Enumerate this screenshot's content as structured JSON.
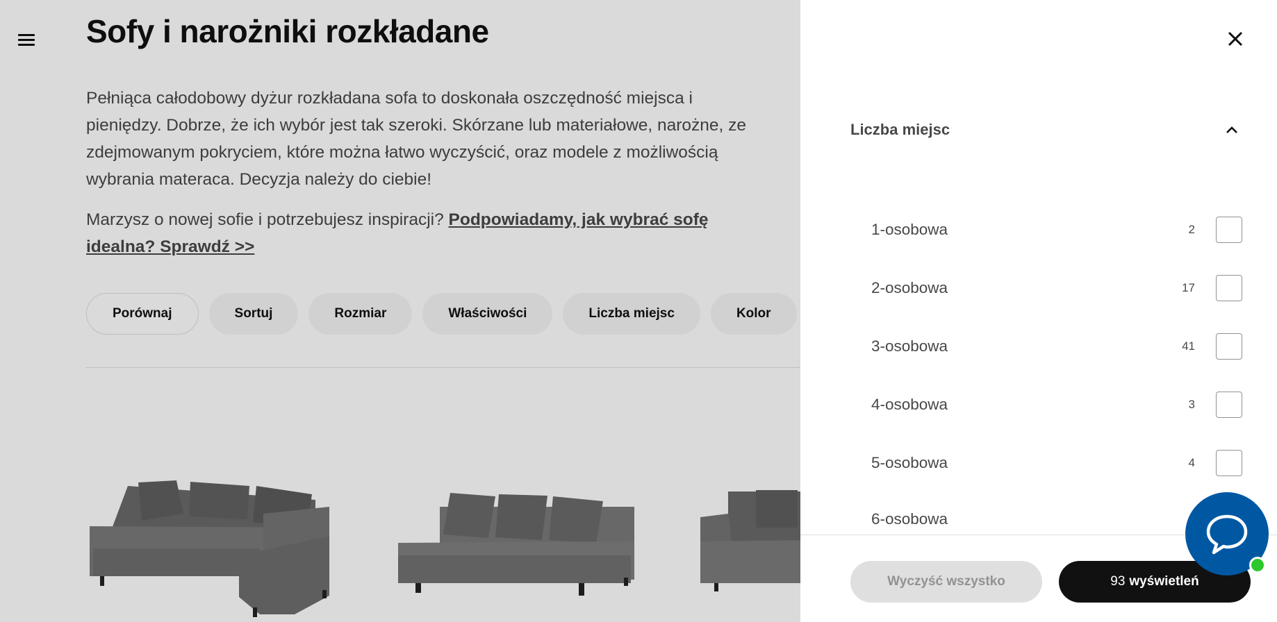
{
  "page": {
    "title": "Sofy i narożniki rozkładane",
    "description": "Pełniąca całodobowy dyżur rozkładana sofa to doskonała oszczędność miejsca i pieniędzy. Dobrze, że ich wybór jest tak szeroki. Skórzane lub materiałowe, narożne, ze zdejmowanym pokryciem, które można łatwo wyczyścić, oraz modele z możliwością wybrania materaca. Decyzja należy do ciebie!",
    "inspiration_text": "Marzysz o nowej sofie i potrzebujesz inspiracji? ",
    "inspiration_link": "Podpowiadamy, jak wybrać sofę idealna? Sprawdź >>"
  },
  "filters": {
    "chips": [
      {
        "label": "Porównaj"
      },
      {
        "label": "Sortuj"
      },
      {
        "label": "Rozmiar"
      },
      {
        "label": "Właściwości"
      },
      {
        "label": "Liczba miejsc"
      },
      {
        "label": "Kolor"
      }
    ]
  },
  "panel": {
    "section_title": "Liczba miejsc",
    "options": [
      {
        "label": "1-osobowa",
        "count": "2",
        "checked": false
      },
      {
        "label": "2-osobowa",
        "count": "17",
        "checked": false
      },
      {
        "label": "3-osobowa",
        "count": "41",
        "checked": false
      },
      {
        "label": "4-osobowa",
        "count": "3",
        "checked": false
      },
      {
        "label": "5-osobowa",
        "count": "4",
        "checked": false
      },
      {
        "label": "6-osobowa",
        "count": "",
        "checked": false
      }
    ],
    "clear_label": "Wyczyść wszystko",
    "show_count": "93",
    "show_label": "wyświetleń"
  },
  "icons": {
    "menu": "hamburger-menu-icon",
    "close": "close-icon",
    "collapse": "chevron-up-icon",
    "chat": "chat-bubble-icon"
  },
  "colors": {
    "chat_blue": "#0058a3",
    "online_green": "#2ec82e",
    "primary_button": "#111111"
  }
}
